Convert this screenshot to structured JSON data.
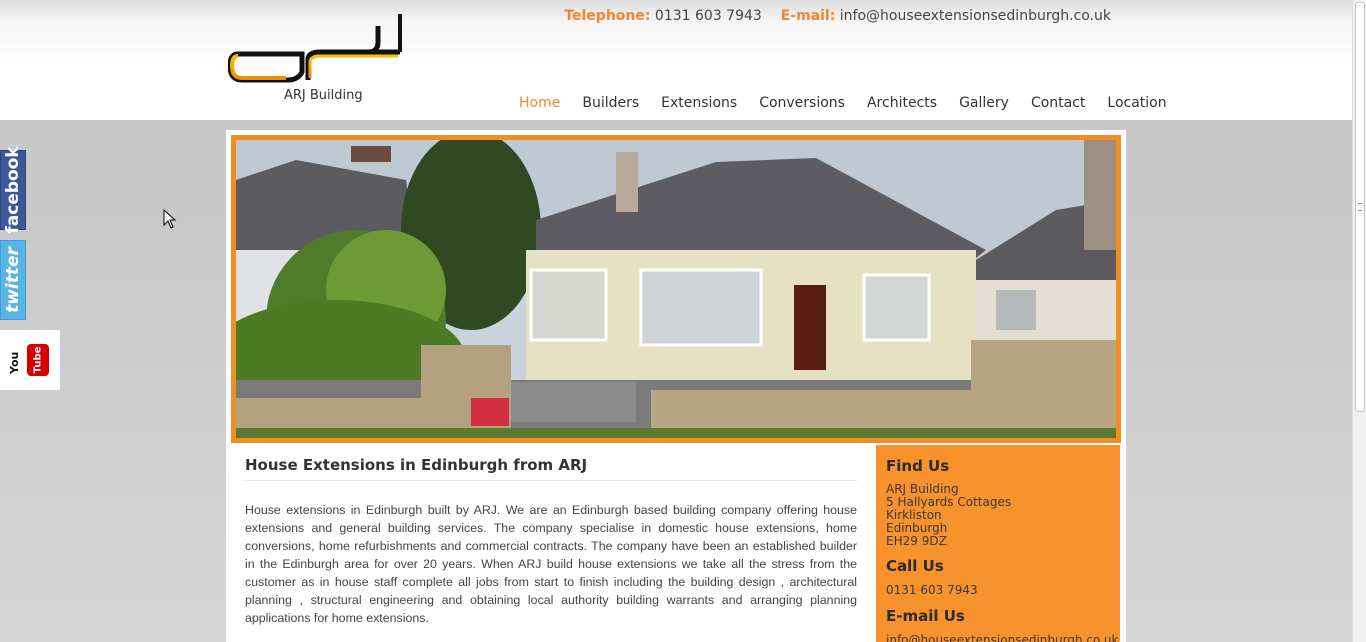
{
  "header": {
    "brand": "ARJ Building",
    "telephone_label": "Telephone:",
    "telephone": "0131 603 7943",
    "email_label": "E-mail:",
    "email": "info@houseextensionsedinburgh.co.uk"
  },
  "nav": {
    "items": [
      {
        "label": "Home",
        "active": true
      },
      {
        "label": "Builders"
      },
      {
        "label": "Extensions"
      },
      {
        "label": "Conversions"
      },
      {
        "label": "Architects"
      },
      {
        "label": "Gallery"
      },
      {
        "label": "Contact"
      },
      {
        "label": "Location"
      }
    ]
  },
  "social": {
    "facebook": "facebook",
    "twitter": "twitter",
    "youtube_you": "You",
    "youtube_tube": "Tube"
  },
  "article": {
    "title": "House Extensions in Edinburgh from ARJ",
    "body": "House extensions in Edinburgh built by ARJ. We are an Edinburgh based building company offering house extensions and general building services. The company specialise in domestic house extensions, home conversions, home refurbishments and commercial contracts. The company have been an established builder in the Edinburgh area for over 20 years. When ARJ build house extensions we take all the stress from the customer as in house staff complete all jobs from start to finish including the building design , architectural planning , structural engineering and obtaining local authority building warrants and arranging planning applications for home extensions."
  },
  "sidebar": {
    "find_title": "Find Us",
    "address": [
      "ARJ Building",
      "5 Hallyards Cottages",
      "Kirkliston",
      "Edinburgh",
      "EH29 9DZ"
    ],
    "call_title": "Call Us",
    "phone": "0131 603 7943",
    "email_title": "E-mail Us",
    "email": "info@houseextensionsedinburgh.co.uk"
  },
  "colors": {
    "accent": "#f0872a",
    "sidebar_bg": "#f7922d"
  }
}
